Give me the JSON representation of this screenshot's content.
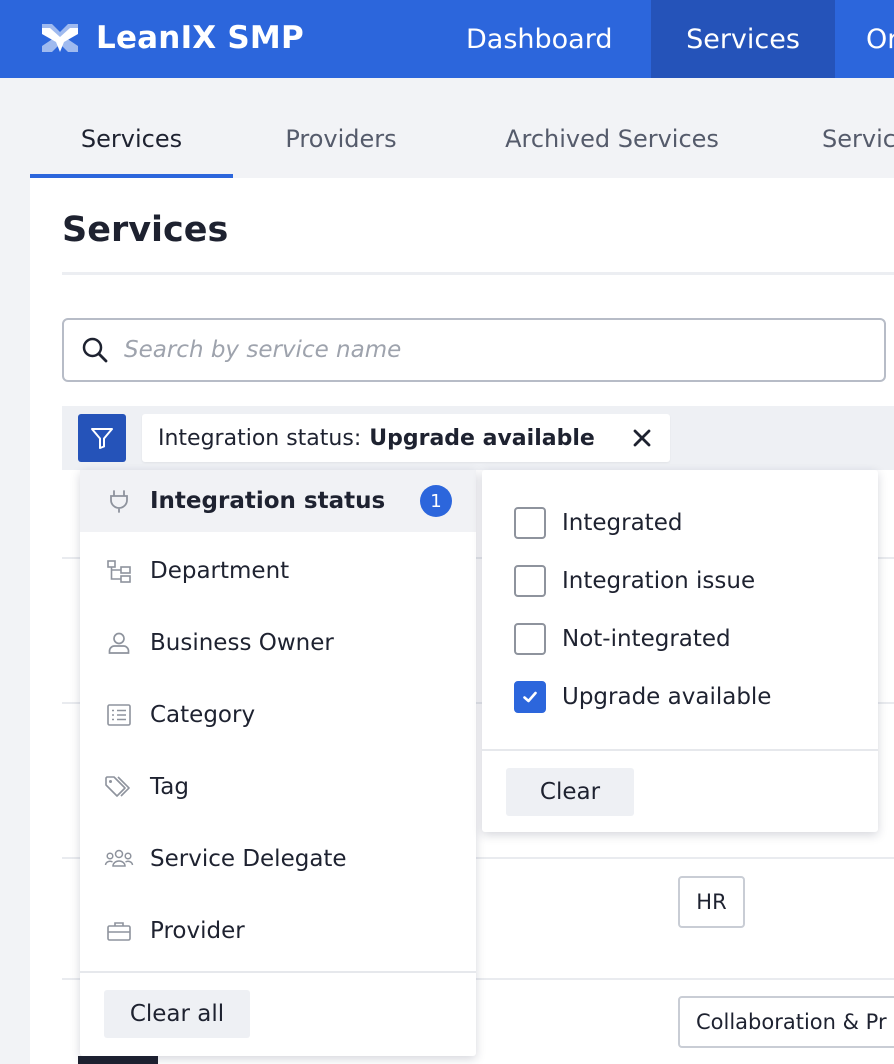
{
  "app": {
    "name": "LeanIX SMP",
    "brand_color": "#2c66dc",
    "logo_icon": "leanix-logo-icon"
  },
  "nav": {
    "items": [
      {
        "label": "Dashboard",
        "active": false
      },
      {
        "label": "Services",
        "active": true
      },
      {
        "label": "Or",
        "active": false
      }
    ]
  },
  "subtabs": [
    {
      "label": "Services",
      "active": true
    },
    {
      "label": "Providers",
      "active": false
    },
    {
      "label": "Archived Services",
      "active": false
    },
    {
      "label": "Servic",
      "active": false
    }
  ],
  "page": {
    "title": "Services"
  },
  "search": {
    "placeholder": "Search by service name",
    "value": ""
  },
  "filter": {
    "chip_key": "Integration status:",
    "chip_value": "Upgrade available"
  },
  "filter_menu": {
    "items": [
      {
        "label": "Integration status",
        "icon": "plug-icon",
        "active": true,
        "badge": "1"
      },
      {
        "label": "Department",
        "icon": "org-tree-icon",
        "active": false
      },
      {
        "label": "Business Owner",
        "icon": "user-icon",
        "active": false
      },
      {
        "label": "Category",
        "icon": "list-icon",
        "active": false
      },
      {
        "label": "Tag",
        "icon": "tag-icon",
        "active": false
      },
      {
        "label": "Service Delegate",
        "icon": "group-icon",
        "active": false
      },
      {
        "label": "Provider",
        "icon": "briefcase-icon",
        "active": false
      }
    ],
    "clear_all_label": "Clear all"
  },
  "status_options": {
    "items": [
      {
        "label": "Integrated",
        "checked": false
      },
      {
        "label": "Integration issue",
        "checked": false
      },
      {
        "label": "Not-integrated",
        "checked": false
      },
      {
        "label": "Upgrade available",
        "checked": true
      }
    ],
    "clear_label": "Clear"
  },
  "table_tags": {
    "hr": "HR",
    "collab": "Collaboration & Pr"
  }
}
